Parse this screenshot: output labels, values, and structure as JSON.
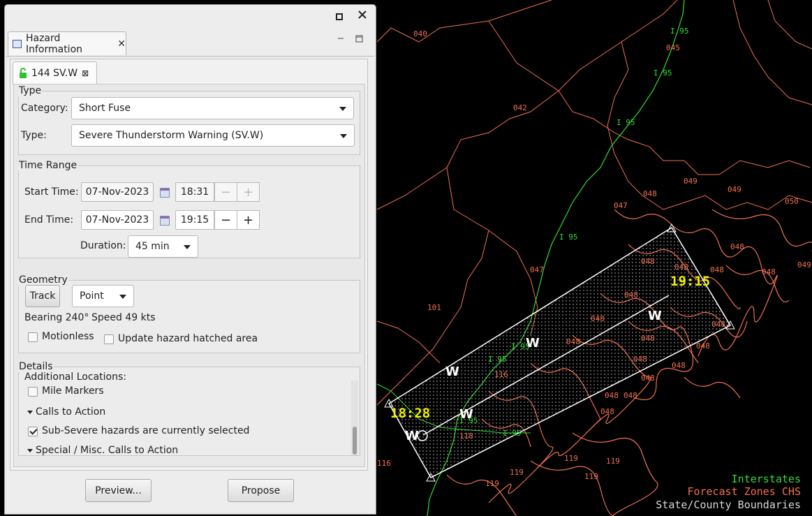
{
  "map": {
    "zone_labels": [
      "040",
      "045",
      "042",
      "049",
      "049",
      "050",
      "048",
      "047",
      "048",
      "048",
      "049",
      "048",
      "048",
      "048",
      "048",
      "047",
      "101",
      "048",
      "048",
      "048",
      "048",
      "048",
      "048",
      "048",
      "048",
      "048",
      "048",
      "048",
      "118",
      "116",
      "119",
      "119",
      "119",
      "119",
      "119",
      "116"
    ],
    "interstate_labels": [
      "I 95",
      "I 95",
      "I 95",
      "I 95",
      "I 95",
      "I 95",
      "I 95",
      "I 95"
    ],
    "time_start": "18:28",
    "time_end": "19:15",
    "w_marks": [
      "W",
      "W",
      "W",
      "W",
      "W"
    ],
    "legend": {
      "interstates": "Interstates",
      "forecast_zones": "Forecast Zones CHS",
      "boundaries": "State/County Boundaries"
    },
    "colors": {
      "interstate": "#33dd33",
      "zone": "#f0714f",
      "boundary": "#d8d8d8",
      "time_label": "#f2f200"
    }
  },
  "window": {
    "maximize_icon": "maximize-icon",
    "close_icon": "close-icon"
  },
  "view": {
    "tab_label": "Hazard Information",
    "close_symbol": "✕",
    "minimize_symbol": "▭",
    "maximize_symbol": "□"
  },
  "hazard_tab": {
    "label": "144 SV.W",
    "lock_icon": "unlock-icon",
    "close_symbol": "⊠"
  },
  "type_section": {
    "legend": "Type",
    "category_label": "Category:",
    "category_value": "Short Fuse",
    "type_label": "Type:",
    "type_value": "Severe Thunderstorm Warning (SV.W)"
  },
  "time_section": {
    "legend": "Time Range",
    "start_label": "Start Time:",
    "start_date": "07-Nov-2023",
    "start_time": "18:31",
    "end_label": "End Time:",
    "end_date": "07-Nov-2023",
    "end_time": "19:15",
    "minus": "−",
    "plus": "+",
    "duration_label": "Duration:",
    "duration_value": "45 min"
  },
  "geometry_section": {
    "legend": "Geometry",
    "track_button": "Track",
    "shape_value": "Point",
    "bearing": "Bearing 240°",
    "speed": "Speed 49 kts",
    "motionless_label": "Motionless",
    "motionless_checked": false,
    "update_label": "Update hazard hatched area",
    "update_checked": false
  },
  "details_section": {
    "legend": "Details",
    "additional_locations": "Additional Locations:",
    "mile_markers": "Mile Markers",
    "calls_to_action": "Calls to Action",
    "sub_severe": "Sub-Severe hazards are currently selected",
    "special_calls": "Special / Misc. Calls to Action"
  },
  "buttons": {
    "preview": "Preview...",
    "propose": "Propose"
  }
}
